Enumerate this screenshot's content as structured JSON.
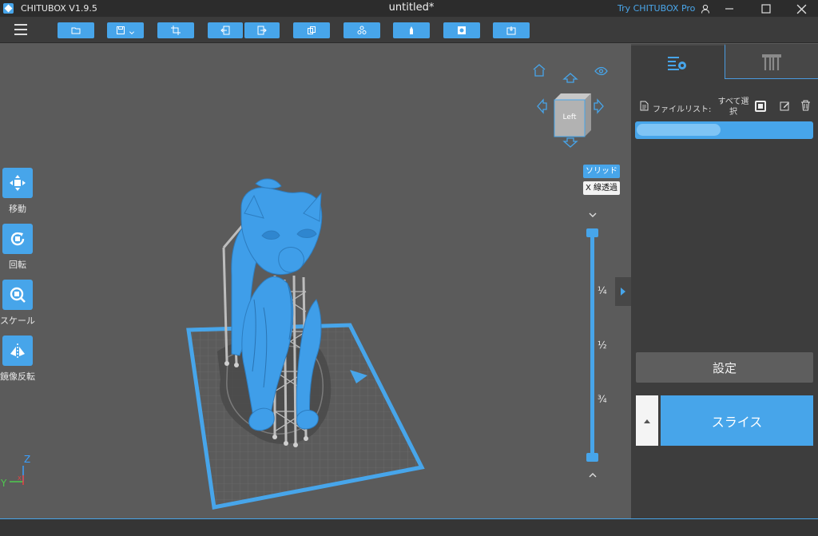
{
  "titlebar": {
    "app_name": "CHITUBOX V1.9.5",
    "doc_title": "untitled*",
    "try_pro": "Try CHITUBOX Pro",
    "user_icon": "user-icon",
    "minimize_icon": "minimize-icon",
    "maximize_icon": "maximize-icon",
    "close_icon": "close-icon"
  },
  "toolbar": {
    "menu_icon": "hamburger-icon",
    "buttons": [
      "open-file-icon",
      "save-icon",
      "crop-icon",
      "import-icon",
      "export-icon",
      "copy-icon",
      "arrange-icon",
      "support-icon",
      "hollow-icon",
      "drill-icon"
    ]
  },
  "left_tools": {
    "move": "移動",
    "rotate": "回転",
    "scale": "スケール",
    "mirror": "鏡像反転"
  },
  "view": {
    "cube_face": "Left",
    "solid": "ソリッド",
    "xray": "X 線透過",
    "fractions": [
      "¼",
      "½",
      "¾"
    ]
  },
  "axes": {
    "z": "Z",
    "y": "Y",
    "x": "X"
  },
  "panel": {
    "filelist_label": "ファイルリスト:",
    "select_all": "すべて選択",
    "settings": "設定",
    "slice": "スライス"
  },
  "colors": {
    "accent": "#47a5ea",
    "model": "#3f9ee9",
    "support": "#b9b9b9",
    "background": "#5b5b5b",
    "panel": "#3d3d3d"
  }
}
